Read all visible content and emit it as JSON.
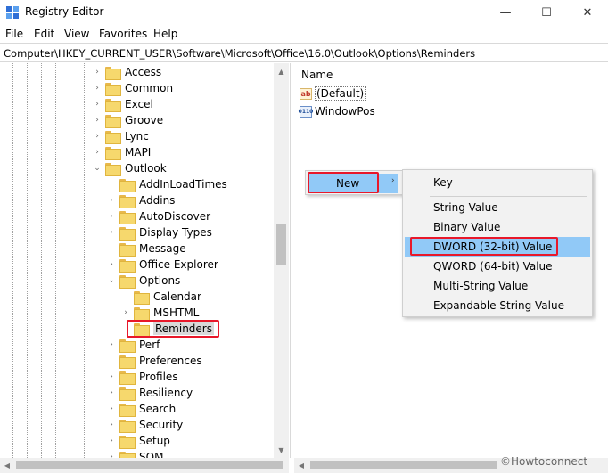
{
  "window": {
    "title": "Registry Editor"
  },
  "window_controls": {
    "minimize": "—",
    "maximize": "☐",
    "close": "✕"
  },
  "menu": [
    "File",
    "Edit",
    "View",
    "Favorites",
    "Help"
  ],
  "address": "Computer\\HKEY_CURRENT_USER\\Software\\Microsoft\\Office\\16.0\\Outlook\\Options\\Reminders",
  "tree": [
    {
      "label": "Access",
      "expanded": false
    },
    {
      "label": "Common",
      "expanded": false
    },
    {
      "label": "Excel",
      "expanded": false
    },
    {
      "label": "Groove",
      "expanded": false
    },
    {
      "label": "Lync",
      "expanded": false
    },
    {
      "label": "MAPI",
      "expanded": false
    },
    {
      "label": "Outlook",
      "expanded": true
    },
    {
      "label": "AddInLoadTimes",
      "expanded": false
    },
    {
      "label": "Addins",
      "expanded": false
    },
    {
      "label": "AutoDiscover",
      "expanded": false
    },
    {
      "label": "Display Types",
      "expanded": false
    },
    {
      "label": "Message",
      "expanded": false
    },
    {
      "label": "Office Explorer",
      "expanded": false
    },
    {
      "label": "Options",
      "expanded": true
    },
    {
      "label": "Calendar",
      "expanded": false
    },
    {
      "label": "MSHTML",
      "expanded": false
    },
    {
      "label": "Reminders",
      "expanded": false,
      "selected": true
    },
    {
      "label": "Perf",
      "expanded": false
    },
    {
      "label": "Preferences",
      "expanded": false
    },
    {
      "label": "Profiles",
      "expanded": false
    },
    {
      "label": "Resiliency",
      "expanded": false
    },
    {
      "label": "Search",
      "expanded": false
    },
    {
      "label": "Security",
      "expanded": false
    },
    {
      "label": "Setup",
      "expanded": false
    },
    {
      "label": "SQM",
      "expanded": false
    }
  ],
  "values_pane": {
    "column_name": "Name",
    "values": [
      {
        "name": "(Default)",
        "icon": "string-value-icon"
      },
      {
        "name": "WindowPos",
        "icon": "binary-value-icon"
      }
    ]
  },
  "context_menu": {
    "new_label": "New",
    "arrow": "›"
  },
  "submenu": {
    "items": [
      "Key",
      "String Value",
      "Binary Value",
      "DWORD (32-bit) Value",
      "QWORD (64-bit) Value",
      "Multi-String Value",
      "Expandable String Value"
    ],
    "highlighted": "DWORD (32-bit) Value"
  },
  "watermark": "©Howtoconnect",
  "colors": {
    "highlight": "#91c9f7",
    "callout_red": "#e8182a",
    "folder": "#f6d86d"
  }
}
